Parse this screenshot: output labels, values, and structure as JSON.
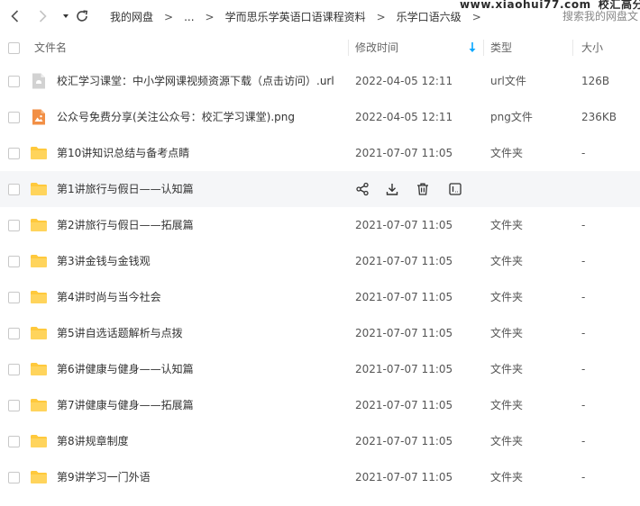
{
  "toolbar": {
    "back_icon": "chevron-left-icon",
    "forward_icon": "chevron-right-icon",
    "history_icon": "caret-down-icon",
    "refresh_icon": "refresh-icon"
  },
  "breadcrumb": {
    "items": [
      "我的网盘",
      "...",
      "学而思乐学英语口语课程资料",
      "乐学口语六级"
    ],
    "separator": ">"
  },
  "watermark": {
    "site": "www.xiaohui77.com",
    "brand": "校汇高分课堂"
  },
  "search": {
    "placeholder": "搜索我的网盘文"
  },
  "columns": {
    "name": "文件名",
    "modified": "修改时间",
    "type": "类型",
    "size": "大小"
  },
  "colors": {
    "accent": "#06a7ff",
    "folder": "#ffc93c",
    "png": "#f28f45",
    "url": "#d2d2d2",
    "hover": "#f5f6f8"
  },
  "row_actions": [
    "share-icon",
    "download-icon",
    "delete-icon",
    "more-icon"
  ],
  "files": [
    {
      "name": "校汇学习课堂：中小学网课视频资源下载（点击访问）.url",
      "modified": "2022-04-05 12:11",
      "type": "url文件",
      "size": "126B",
      "icon": "url-file-icon"
    },
    {
      "name": "公众号免费分享(关注公众号：校汇学习课堂).png",
      "modified": "2022-04-05 12:11",
      "type": "png文件",
      "size": "236KB",
      "icon": "image-file-icon"
    },
    {
      "name": "第10讲知识总结与备考点睛",
      "modified": "2021-07-07 11:05",
      "type": "文件夹",
      "size": "-",
      "icon": "folder-icon"
    },
    {
      "name": "第1讲旅行与假日——认知篇",
      "modified": "",
      "type": "",
      "size": "",
      "icon": "folder-icon",
      "hovered": true
    },
    {
      "name": "第2讲旅行与假日——拓展篇",
      "modified": "2021-07-07 11:05",
      "type": "文件夹",
      "size": "-",
      "icon": "folder-icon"
    },
    {
      "name": "第3讲金钱与金钱观",
      "modified": "2021-07-07 11:05",
      "type": "文件夹",
      "size": "-",
      "icon": "folder-icon"
    },
    {
      "name": "第4讲时尚与当今社会",
      "modified": "2021-07-07 11:05",
      "type": "文件夹",
      "size": "-",
      "icon": "folder-icon"
    },
    {
      "name": "第5讲自选话题解析与点拨",
      "modified": "2021-07-07 11:05",
      "type": "文件夹",
      "size": "-",
      "icon": "folder-icon"
    },
    {
      "name": "第6讲健康与健身——认知篇",
      "modified": "2021-07-07 11:05",
      "type": "文件夹",
      "size": "-",
      "icon": "folder-icon"
    },
    {
      "name": "第7讲健康与健身——拓展篇",
      "modified": "2021-07-07 11:05",
      "type": "文件夹",
      "size": "-",
      "icon": "folder-icon"
    },
    {
      "name": "第8讲规章制度",
      "modified": "2021-07-07 11:05",
      "type": "文件夹",
      "size": "-",
      "icon": "folder-icon"
    },
    {
      "name": "第9讲学习一门外语",
      "modified": "2021-07-07 11:05",
      "type": "文件夹",
      "size": "-",
      "icon": "folder-icon"
    }
  ]
}
